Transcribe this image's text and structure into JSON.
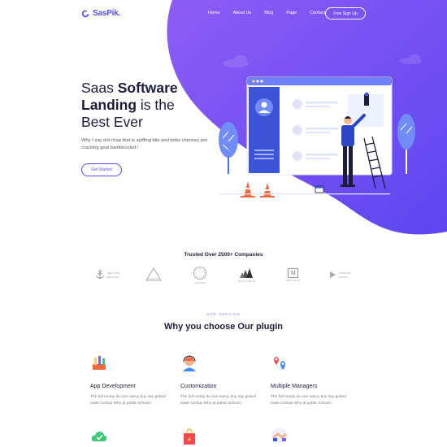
{
  "brand": {
    "name": "SasPik.",
    "accent": "#5b4df5"
  },
  "nav": {
    "links": [
      "Home",
      "About Us",
      "Blog",
      "Page",
      "Contact"
    ],
    "cta": "Free Sign Up"
  },
  "hero": {
    "title_prefix": "Saas ",
    "title_bold_1": "Software",
    "title_bold_2": "Landing",
    "title_mid": " is the",
    "title_end": "Best Ever",
    "description": "Why I say old chap that is spiffing bits and bobs chimney pot cracking goal bamboozled.!",
    "button": "Get Started"
  },
  "trusted": {
    "heading": "Trusted Over 2500+ Companies",
    "brands": [
      {
        "name": "SEA TIME",
        "sub": "BOATING",
        "icon": "anchor-icon"
      },
      {
        "name": "",
        "sub": "",
        "icon": "triangle-icon"
      },
      {
        "name": "CLASSIC",
        "sub": "",
        "icon": "circle-badge-icon"
      },
      {
        "name": "BLACK PEAK",
        "sub": "",
        "icon": "trees-icon"
      },
      {
        "name": "M",
        "sub": "MAX TECH",
        "icon": "square-letter-icon"
      },
      {
        "name": "GROOVE",
        "sub": "MUSIC",
        "icon": "play-icon"
      }
    ]
  },
  "services": {
    "label": "OUR SERVICE",
    "title": "Why you choose Our plugin",
    "items": [
      {
        "title": "App Development",
        "desc": "The full monty do one nancy boy say gutted mate cockup Why at public school.!",
        "icon": "paint-brushes-icon"
      },
      {
        "title": "Customization",
        "desc": "The full monty do one nancy boy say gutted mate cockup Why at public school.!",
        "icon": "support-agent-icon"
      },
      {
        "title": "Multiple Managers",
        "desc": "The full monty do one nancy boy say gutted mate cockup Why at public school.!",
        "icon": "map-pins-icon"
      },
      {
        "title": "",
        "desc": "",
        "icon": "cloud-check-icon"
      },
      {
        "title": "",
        "desc": "",
        "icon": "shopping-bag-icon"
      },
      {
        "title": "",
        "desc": "",
        "icon": "handshake-icon"
      }
    ]
  }
}
